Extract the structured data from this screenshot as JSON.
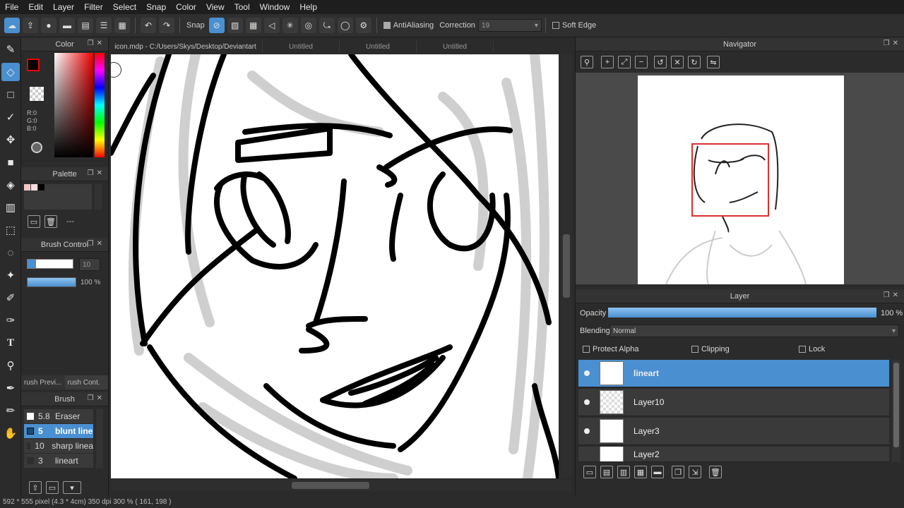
{
  "menu": [
    "File",
    "Edit",
    "Layer",
    "Filter",
    "Select",
    "Snap",
    "Color",
    "View",
    "Tool",
    "Window",
    "Help"
  ],
  "toolbar": {
    "snap": "Snap",
    "antialiasing": "AntiAliasing",
    "correction_label": "Correction",
    "correction_value": "19",
    "soft_edge": "Soft Edge"
  },
  "color_panel": {
    "title": "Color",
    "r": "R:0",
    "g": "G:0",
    "b": "B:0"
  },
  "palette_panel": {
    "title": "Palette",
    "status": "---"
  },
  "brush_control": {
    "title": "Brush Control",
    "size": "10",
    "opacity": "100 %",
    "size_fraction": 0.9,
    "opacity_fraction": 1.0
  },
  "brush_tabs": [
    "rush Previ...",
    "rush Cont."
  ],
  "brush_panel": {
    "title": "Brush",
    "items": [
      {
        "size": "5.8",
        "name": "Eraser"
      },
      {
        "size": "5",
        "name": "blunt line"
      },
      {
        "size": "10",
        "name": "sharp linea"
      },
      {
        "size": "3",
        "name": "lineart"
      }
    ],
    "selected": 1
  },
  "tabs": [
    "icon.mdp - C:/Users/Skys/Desktop/Deviantart",
    "Untitled",
    "Untitled",
    "Untitled"
  ],
  "navigator": {
    "title": "Navigator"
  },
  "layer_panel": {
    "title": "Layer",
    "opacity_label": "Opacity",
    "opacity_value": "100 %",
    "opacity_fraction": 1.0,
    "blending_label": "Blending",
    "blending_value": "Normal",
    "protect_alpha": "Protect Alpha",
    "clipping": "Clipping",
    "lock": "Lock",
    "layers": [
      "lineart",
      "Layer10",
      "Layer3",
      "Layer2"
    ],
    "selected": 0
  },
  "status": "592 * 555 pixel  (4.3 * 4cm)  350 dpi  300 %  ( 161, 198 )",
  "colors": {
    "accent": "#4a8fd0",
    "fg_color": "#000000"
  }
}
